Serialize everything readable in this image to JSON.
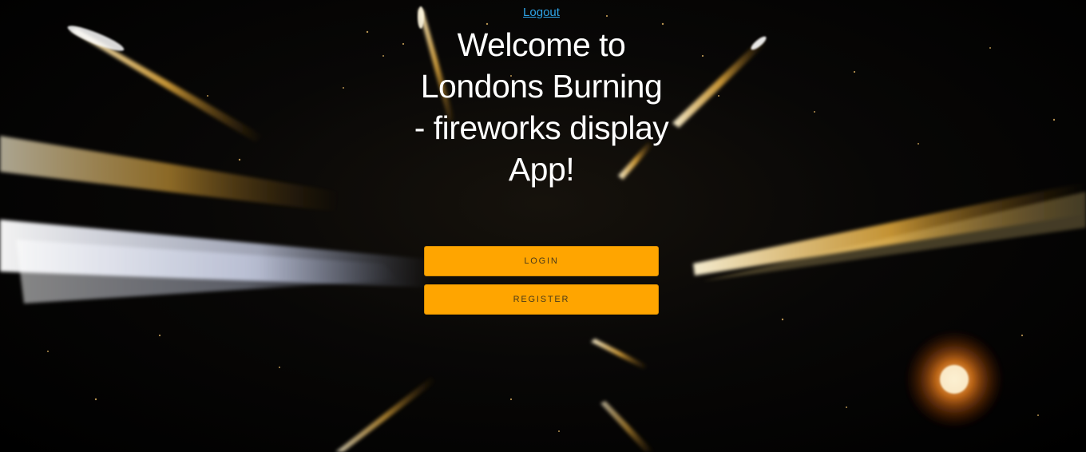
{
  "header": {
    "logout_label": "Logout"
  },
  "main": {
    "title": "Welcome to Londons Burning - fireworks display App!",
    "login_label": "LOGIN",
    "register_label": "REGISTER"
  },
  "background": {
    "description_icon": "fireworks-background",
    "accent_color": "#ffa500",
    "link_color": "#2ea3e6"
  }
}
